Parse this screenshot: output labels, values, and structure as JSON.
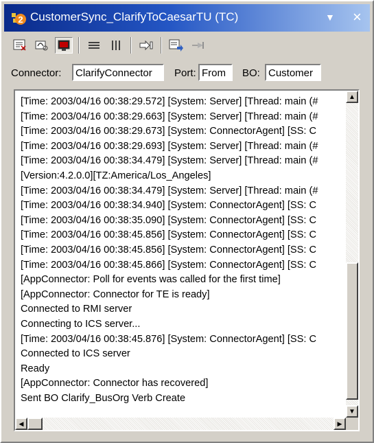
{
  "window": {
    "title": "CustomerSync_ClarifyToCaesarTU (TC)",
    "menu_glyph": "▼",
    "close_glyph": "×"
  },
  "toolbar": {
    "buttons": [
      {
        "name": "properties-icon"
      },
      {
        "name": "connect-icon"
      },
      {
        "name": "monitor-icon",
        "pressed": true
      },
      {
        "name": "horizontal-layout-icon"
      },
      {
        "name": "vertical-layout-icon"
      },
      {
        "name": "forward-icon"
      },
      {
        "name": "send-message-icon"
      },
      {
        "name": "pin-icon"
      }
    ]
  },
  "fields": {
    "connector_label": "Connector:",
    "connector_value": "ClarifyConnector",
    "port_label": "Port:",
    "port_value": "From",
    "bo_label": "BO:",
    "bo_value": "Customer"
  },
  "log": {
    "lines": [
      "[Time: 2003/04/16 00:38:29.572] [System: Server] [Thread: main (#",
      "[Time: 2003/04/16 00:38:29.663] [System: Server] [Thread: main (#",
      "[Time: 2003/04/16 00:38:29.673] [System: ConnectorAgent] [SS: C",
      "[Time: 2003/04/16 00:38:29.693] [System: Server] [Thread: main (#",
      "[Time: 2003/04/16 00:38:34.479] [System: Server] [Thread: main (#",
      "[Version:4.2.0.0][TZ:America/Los_Angeles]",
      "[Time: 2003/04/16 00:38:34.479] [System: Server] [Thread: main (#",
      "[Time: 2003/04/16 00:38:34.940] [System: ConnectorAgent] [SS: C",
      "[Time: 2003/04/16 00:38:35.090] [System: ConnectorAgent] [SS: C",
      "[Time: 2003/04/16 00:38:45.856] [System: ConnectorAgent] [SS: C",
      "[Time: 2003/04/16 00:38:45.856] [System: ConnectorAgent] [SS: C",
      "[Time: 2003/04/16 00:38:45.866] [System: ConnectorAgent] [SS: C",
      "[AppConnector: Poll for events was called for the first time]",
      "[AppConnector: Connector for TE is ready]",
      "Connected to RMI server",
      "Connecting to ICS server...",
      "[Time: 2003/04/16 00:38:45.876] [System: ConnectorAgent] [SS: C",
      "Connected to ICS server",
      "Ready",
      "[AppConnector: Connector has recovered]",
      "Sent BO Clarify_BusOrg Verb Create"
    ]
  },
  "scrollbar": {
    "up_glyph": "▲",
    "down_glyph": "▼",
    "left_glyph": "◀",
    "right_glyph": "▶"
  }
}
